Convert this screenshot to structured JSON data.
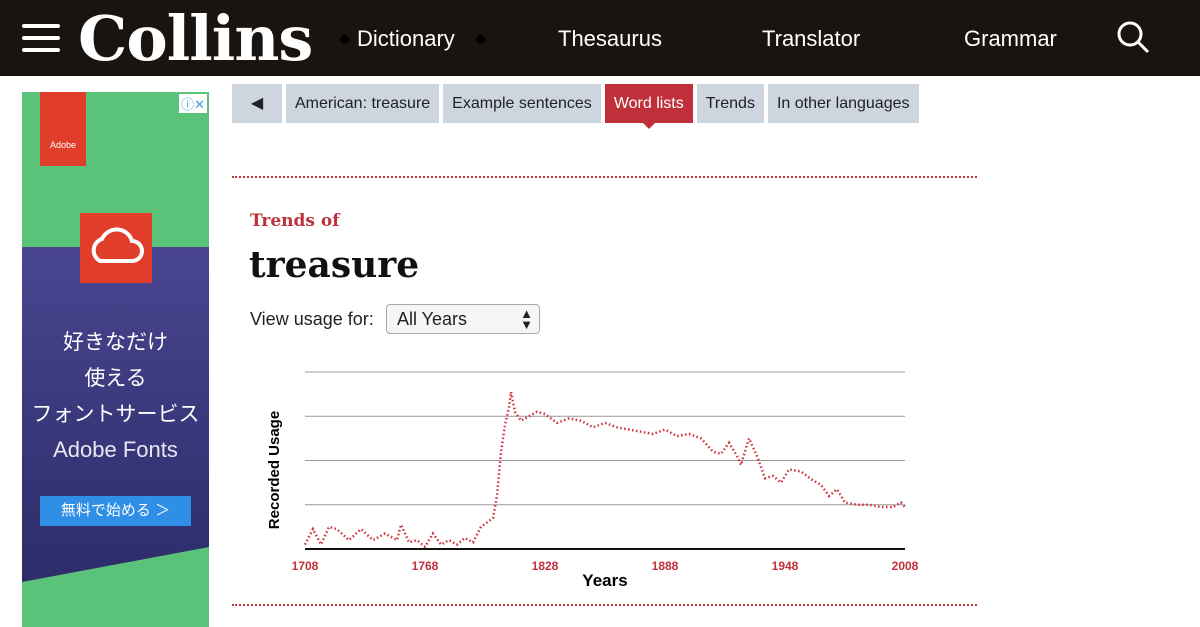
{
  "header": {
    "logo": "Collins",
    "nav": [
      "Dictionary",
      "Thesaurus",
      "Translator",
      "Grammar"
    ]
  },
  "ad": {
    "brand": "Adobe",
    "lines": [
      "好きなだけ",
      "使える",
      "フォントサービス"
    ],
    "product": "Adobe Fonts",
    "cta": "無料で始める ＞"
  },
  "tabs": [
    "American: treasure",
    "Example sentences",
    "Word lists",
    "Trends",
    "In other languages"
  ],
  "active_tab": "Word lists",
  "trends": {
    "heading": "Trends of",
    "word": "treasure",
    "view_label": "View usage for:",
    "view_value": "All Years"
  },
  "colors": {
    "accent": "#c0303a",
    "topbar": "#1a1410",
    "tab": "#cdd5df"
  },
  "chart_data": {
    "type": "line",
    "xlabel": "Years",
    "ylabel": "Recorded Usage",
    "xlim": [
      1708,
      2008
    ],
    "ylim": [
      0,
      4
    ],
    "grid": true,
    "xticks": [
      "1708",
      "1768",
      "1828",
      "1888",
      "1948",
      "2008"
    ],
    "x": [
      1708,
      1712,
      1716,
      1720,
      1724,
      1730,
      1736,
      1742,
      1748,
      1754,
      1756,
      1760,
      1764,
      1768,
      1772,
      1776,
      1780,
      1784,
      1788,
      1792,
      1796,
      1799,
      1802,
      1804,
      1806,
      1808,
      1810,
      1811,
      1813,
      1816,
      1820,
      1824,
      1828,
      1834,
      1840,
      1846,
      1852,
      1858,
      1864,
      1870,
      1876,
      1882,
      1888,
      1894,
      1900,
      1906,
      1912,
      1916,
      1920,
      1924,
      1926,
      1930,
      1934,
      1938,
      1942,
      1946,
      1950,
      1956,
      1962,
      1966,
      1970,
      1974,
      1978,
      1984,
      1990,
      1996,
      2002,
      2006,
      2008
    ],
    "values": [
      0.1,
      0.45,
      0.1,
      0.5,
      0.45,
      0.2,
      0.45,
      0.2,
      0.35,
      0.2,
      0.55,
      0.15,
      0.2,
      0.05,
      0.35,
      0.1,
      0.2,
      0.1,
      0.25,
      0.15,
      0.5,
      0.6,
      0.7,
      1.2,
      2.2,
      2.8,
      3.2,
      3.55,
      3.1,
      2.9,
      3.0,
      3.1,
      3.05,
      2.85,
      2.95,
      2.9,
      2.75,
      2.85,
      2.75,
      2.7,
      2.65,
      2.6,
      2.7,
      2.55,
      2.6,
      2.5,
      2.2,
      2.15,
      2.4,
      2.1,
      1.9,
      2.5,
      2.1,
      1.6,
      1.65,
      1.5,
      1.8,
      1.75,
      1.55,
      1.45,
      1.2,
      1.35,
      1.05,
      1.0,
      1.0,
      0.95,
      0.95,
      1.05,
      0.95
    ]
  }
}
